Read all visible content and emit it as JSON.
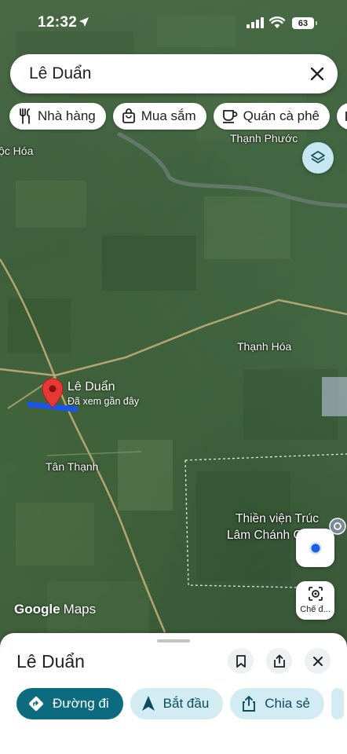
{
  "status_bar": {
    "time": "12:32",
    "battery": "63"
  },
  "search": {
    "query": "Lê Duẩn"
  },
  "chips": [
    {
      "label": "Nhà hàng",
      "icon": "restaurant-icon"
    },
    {
      "label": "Mua sắm",
      "icon": "shopping-bag-icon"
    },
    {
      "label": "Quán cà phê",
      "icon": "coffee-icon"
    }
  ],
  "map": {
    "labels": {
      "moc_hoa": "ộc Hóa",
      "thanh_phuoc": "Thạnh Phước",
      "thanh_hoa": "Thạnh Hóa",
      "tan_thanh": "Tân Thạnh",
      "thien_vien_1": "Thiền viện Trúc",
      "thien_vien_2": "Lâm Chánh G"
    },
    "place": {
      "name": "Lê Duẩn",
      "subtitle": "Đã xem gần đây"
    },
    "branding": {
      "google": "Google",
      "maps": "Maps"
    },
    "lens_label": "Chế đ..."
  },
  "sheet": {
    "title": "Lê Duẩn",
    "actions": [
      {
        "label": "Đường đi",
        "icon": "directions-icon"
      },
      {
        "label": "Bắt đầu",
        "icon": "navigation-arrow-icon"
      },
      {
        "label": "Chia sẻ",
        "icon": "share-icon"
      }
    ]
  },
  "colors": {
    "primary_action": "#0d6b80",
    "secondary_action": "#d3ecf4",
    "pin": "#e53935",
    "route": "#1a56e8"
  }
}
